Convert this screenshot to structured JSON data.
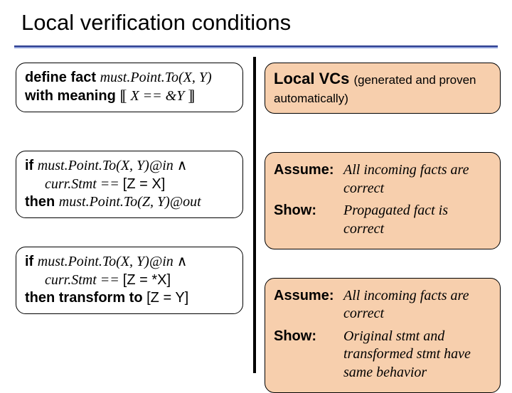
{
  "title": "Local verification conditions",
  "left": {
    "define": {
      "l1a": "define fact ",
      "l1b": "must.Point.To(X, Y)",
      "l2a": "with meaning ",
      "l2b_open": "⟦",
      "l2b_mid": " X == &Y ",
      "l2b_close": "⟧"
    },
    "rule1": {
      "if": "if  ",
      "p1": "must.Point.To(X, Y)@in ",
      "and": "∧",
      "p2": "curr.Stmt == ",
      "p2b": "[Z = X]",
      "then": "then  ",
      "c": "must.Point.To(Z, Y)@out"
    },
    "rule2": {
      "if": "if  ",
      "p1": "must.Point.To(X, Y)@in ",
      "and": "∧",
      "p2": "curr.Stmt == ",
      "p2b": "[Z = *X]",
      "then": "then transform to ",
      "c": "[Z = Y]"
    }
  },
  "right": {
    "header": {
      "strong": "Local VCs ",
      "sub": "(generated and proven automatically)"
    },
    "vc1": {
      "assume_label": "Assume:",
      "assume_val": "All incoming facts are correct",
      "show_label": "Show:",
      "show_val": "Propagated fact is correct"
    },
    "vc2": {
      "assume_label": "Assume:",
      "assume_val": "All incoming facts are correct",
      "show_label": "Show:",
      "show_val": "Original stmt and transformed stmt have same behavior"
    }
  }
}
